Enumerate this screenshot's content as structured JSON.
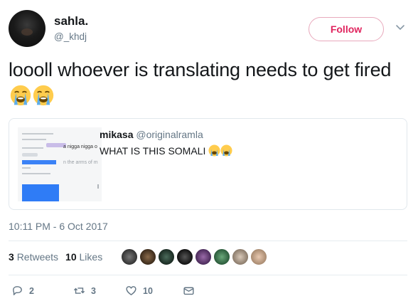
{
  "author": {
    "display_name": "sahla.",
    "handle": "@_khdj",
    "follow_label": "Follow"
  },
  "tweet": {
    "text": "loooll whoever is translating needs to get fired",
    "emojis": [
      "loudly-crying-face",
      "loudly-crying-face"
    ],
    "timestamp": "10:11 PM - 6 Oct 2017"
  },
  "quoted_tweet": {
    "display_name": "mikasa",
    "handle": "@originalramla",
    "text": "WHAT IS THIS SOMALI",
    "emojis": [
      "loudly-crying-face",
      "loudly-crying-face"
    ],
    "media_text": {
      "line1": "a nigga nigga o",
      "line2": "n the arms of m"
    }
  },
  "stats": {
    "retweets_count": "3",
    "retweets_label": "Retweets",
    "likes_count": "10",
    "likes_label": "Likes"
  },
  "actions": {
    "reply_count": "2",
    "retweet_count": "3",
    "like_count": "10"
  },
  "colors": {
    "follow": "#e0245e",
    "secondary": "#657786",
    "primary": "#14171a"
  }
}
